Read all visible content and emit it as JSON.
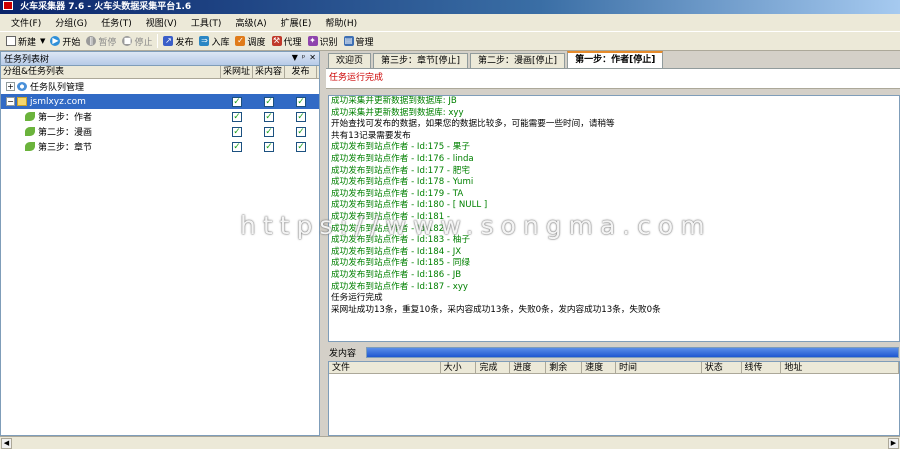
{
  "window": {
    "title": "火车采集器 7.6 - 火车头数据采集平台1.6"
  },
  "menu": [
    "文件(F)",
    "分组(G)",
    "任务(T)",
    "视图(V)",
    "工具(T)",
    "高级(A)",
    "扩展(E)",
    "帮助(H)"
  ],
  "toolbar": {
    "new": "新建",
    "start": "开始",
    "pause": "暂停",
    "stop": "停止",
    "publish": "发布",
    "import": "入库",
    "schedule": "调度",
    "proxy": "代理",
    "identify": "识别",
    "manage": "管理"
  },
  "left_panel": {
    "title": "任务列表树",
    "col_name": "分组&任务列表",
    "col_url": "采网址",
    "col_content": "采内容",
    "col_publish": "发布",
    "queue": "任务队列管理",
    "group": "jsmlxyz.com",
    "tasks": [
      "第一步：作者",
      "第二步：漫画",
      "第三步：章节"
    ]
  },
  "tabs": [
    "欢迎页",
    "第三步：章节[停止]",
    "第二步：漫画[停止]",
    "第一步：作者[停止]"
  ],
  "status_text": "任务运行完成",
  "log": [
    {
      "text": "成功采集并更新数据到数据库: JB",
      "color": "green"
    },
    {
      "text": "成功采集并更新数据到数据库: xyy",
      "color": "green"
    },
    {
      "text": "开始查找可发布的数据，如果您的数据比较多，可能需要一些时间，请稍等",
      "color": "black"
    },
    {
      "text": "共有13记录需要发布",
      "color": "black"
    },
    {
      "text": "成功发布到站点作者 - Id:175 - 果子",
      "color": "green"
    },
    {
      "text": "成功发布到站点作者 - Id:176 - linda",
      "color": "green"
    },
    {
      "text": "成功发布到站点作者 - Id:177 - 肥宅",
      "color": "green"
    },
    {
      "text": "成功发布到站点作者 - Id:178 - Yumi",
      "color": "green"
    },
    {
      "text": "成功发布到站点作者 - Id:179 - TA",
      "color": "green"
    },
    {
      "text": "成功发布到站点作者 - Id:180 - [ NULL ]",
      "color": "green"
    },
    {
      "text": "成功发布到站点作者 - Id:181 - ",
      "color": "green"
    },
    {
      "text": "成功发布到站点作者 - Id:182 - ",
      "color": "green"
    },
    {
      "text": "成功发布到站点作者 - Id:183 - 柚子",
      "color": "green"
    },
    {
      "text": "成功发布到站点作者 - Id:184 - JX",
      "color": "green"
    },
    {
      "text": "成功发布到站点作者 - Id:185 - 同绿",
      "color": "green"
    },
    {
      "text": "成功发布到站点作者 - Id:186 - JB",
      "color": "green"
    },
    {
      "text": "成功发布到站点作者 - Id:187 - xyy",
      "color": "green"
    },
    {
      "text": "任务运行完成",
      "color": "black"
    },
    {
      "text": "采网址成功13条，重复10条，采内容成功13条，失败0条，发内容成功13条，失败0条",
      "color": "black"
    }
  ],
  "progress": {
    "label": "发内容",
    "value": 1.0
  },
  "file_list": {
    "columns": [
      "文件",
      "大小",
      "完成",
      "进度",
      "剩余",
      "速度",
      "时间",
      "状态",
      "线传",
      "地址"
    ]
  },
  "watermark": "https://www.songma.com",
  "colors": {
    "title_bar": "#0a246a",
    "selection": "#316ac5",
    "log_green": "#008000",
    "status_red": "#cc0000",
    "progress": "#1f56d0"
  }
}
